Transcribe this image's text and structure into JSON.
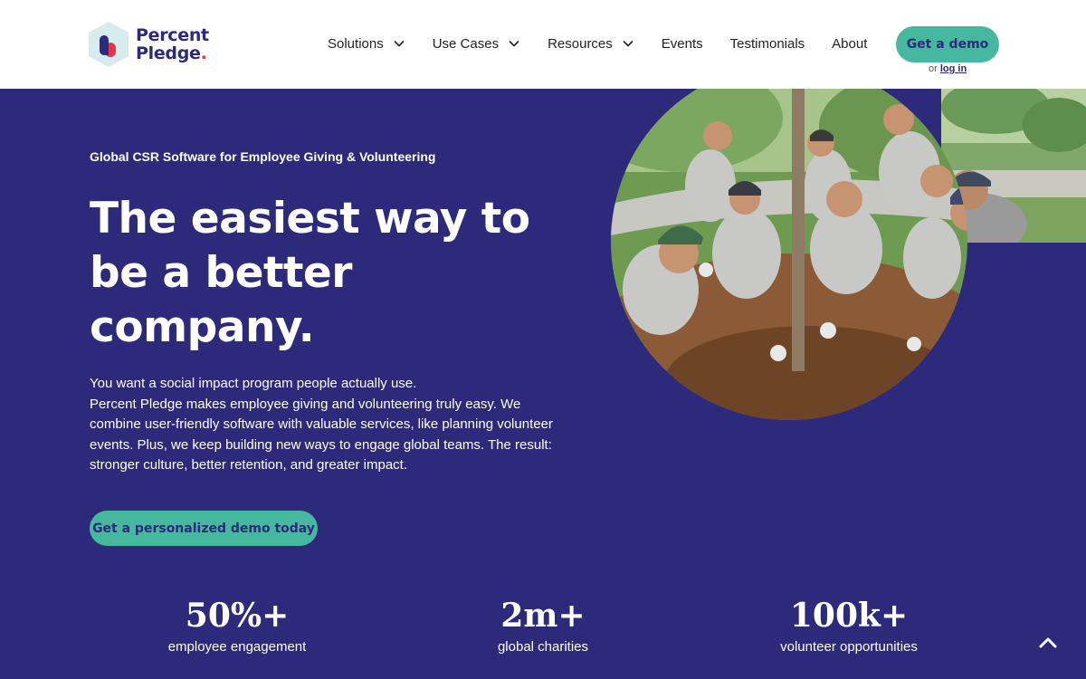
{
  "brand": {
    "name_line1": "Percent",
    "name_line2": "Pledge",
    "dot": "."
  },
  "nav": {
    "items": [
      {
        "label": "Solutions",
        "has_dropdown": true
      },
      {
        "label": "Use Cases",
        "has_dropdown": true
      },
      {
        "label": "Resources",
        "has_dropdown": true
      },
      {
        "label": "Events",
        "has_dropdown": false
      },
      {
        "label": "Testimonials",
        "has_dropdown": false
      },
      {
        "label": "About",
        "has_dropdown": false
      }
    ],
    "cta_label": "Get a demo",
    "login_prefix": "or",
    "login_label": "log in"
  },
  "hero": {
    "eyebrow": "Global CSR Software for Employee Giving & Volunteering",
    "headline_line1": "The easiest way to",
    "headline_line2": "be a better",
    "headline_line3": "company.",
    "desc_line1": "You want a social impact program people actually use.",
    "desc_line2": "Percent Pledge makes employee giving and volunteering truly easy. We combine user-friendly software with valuable services, like planning volunteer events. Plus, we keep building new ways to engage global teams. The result: stronger culture, better retention, and greater impact.",
    "cta_label": "Get a personalized demo today"
  },
  "stats": [
    {
      "value": "50%+",
      "label": "employee engagement"
    },
    {
      "value": "2m+",
      "label": "global charities"
    },
    {
      "value": "100k+",
      "label": "volunteer opportunities"
    }
  ],
  "colors": {
    "primary": "#2d2a7b",
    "accent": "#47b8a0",
    "brand_red": "#e5344a",
    "header_bg": "#ffffff"
  },
  "icons": {
    "dropdown": "chevron-down-icon",
    "scroll_top": "chevron-up-icon"
  }
}
